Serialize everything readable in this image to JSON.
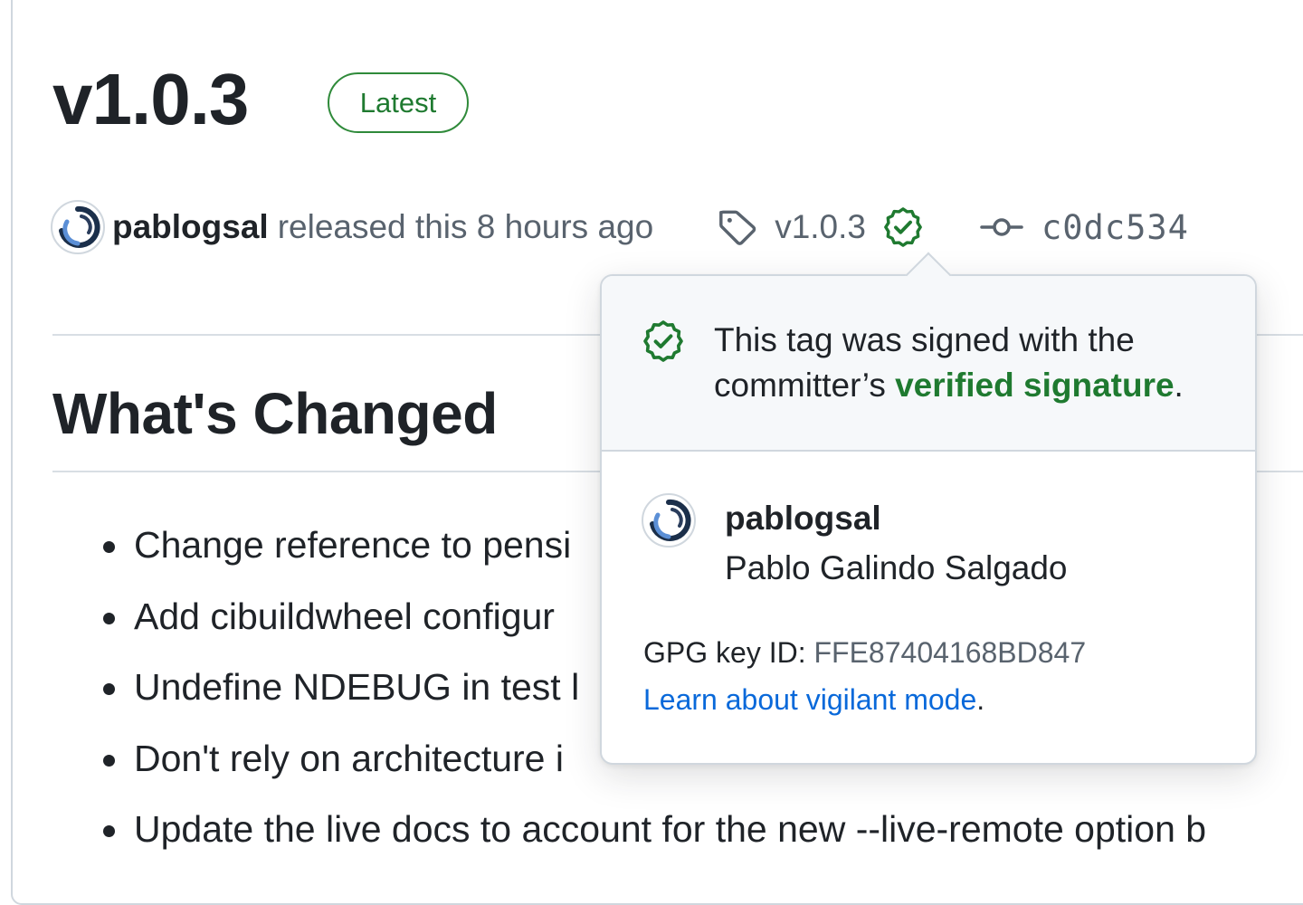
{
  "release": {
    "title": "v1.0.3",
    "badge": "Latest",
    "author": "pablogsal",
    "released_text": "released this 8 hours ago",
    "tag": "v1.0.3",
    "commit": "c0dc534"
  },
  "section": {
    "heading": "What's Changed"
  },
  "changes": [
    "Change reference to pensi",
    "Add cibuildwheel configur",
    "Undefine NDEBUG in test l",
    "Don't rely on architecture i",
    "Update the live docs to account for the new --live-remote option b"
  ],
  "popover": {
    "message_prefix": "This tag was signed with the committer’s ",
    "message_link": "verified signature",
    "message_suffix": ".",
    "signer_login": "pablogsal",
    "signer_name": "Pablo Galindo Salgado",
    "gpg_label": "GPG key ID: ",
    "gpg_key": "FFE87404168BD847",
    "learn_link": "Learn about vigilant mode",
    "learn_suffix": "."
  },
  "colors": {
    "verified_green": "#1f7a30",
    "link_blue": "#0969da",
    "muted": "#59636e",
    "text": "#1f2328"
  },
  "icons": [
    "tag-icon",
    "verified-check-icon",
    "git-commit-icon",
    "avatar-icon"
  ]
}
